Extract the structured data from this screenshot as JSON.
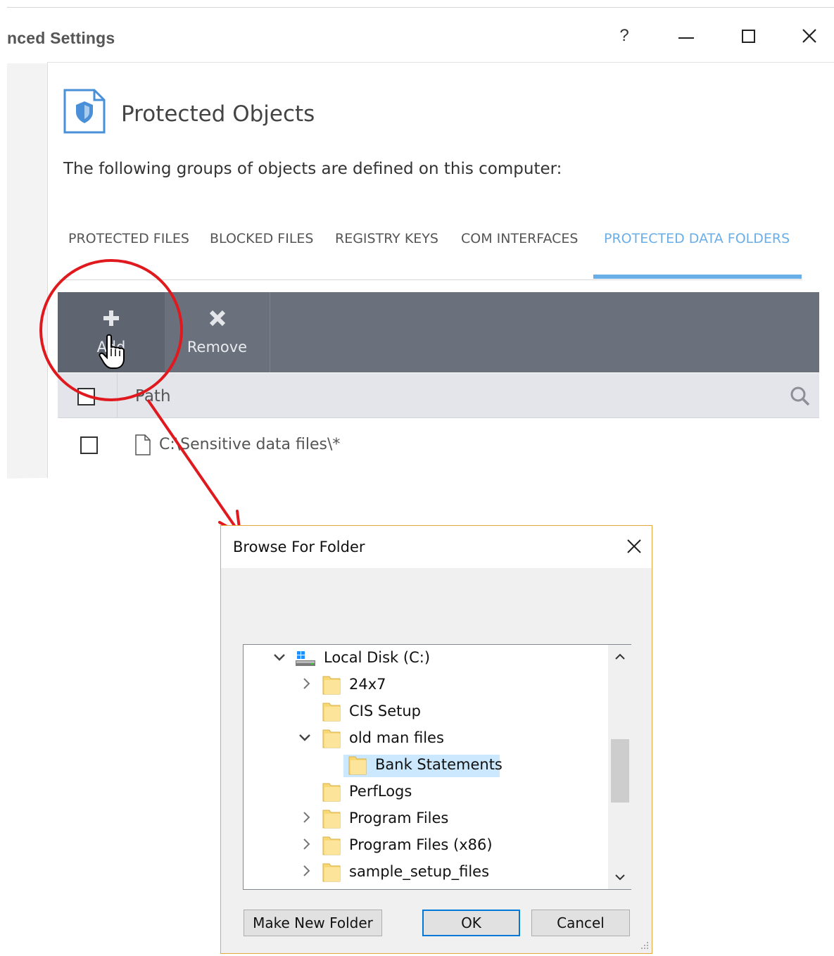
{
  "window": {
    "title": "nced Settings",
    "controls": {
      "help": "?"
    }
  },
  "section": {
    "title": "Protected Objects",
    "description": "The following groups of objects are defined on this computer:"
  },
  "tabs": [
    {
      "label": "PROTECTED FILES",
      "active": false
    },
    {
      "label": "BLOCKED FILES",
      "active": false
    },
    {
      "label": "REGISTRY KEYS",
      "active": false
    },
    {
      "label": "COM INTERFACES",
      "active": false
    },
    {
      "label": "PROTECTED DATA FOLDERS",
      "active": true
    }
  ],
  "toolbar": {
    "add_label": "Add",
    "add_icon": "plus-icon",
    "remove_label": "Remove",
    "remove_icon": "x-icon"
  },
  "grid": {
    "column_header": "Path",
    "rows": [
      {
        "path": "C:\\Sensitive data files\\*"
      }
    ]
  },
  "dialog": {
    "title": "Browse For Folder",
    "tree": [
      {
        "label": "Local Disk (C:)",
        "icon": "drive-icon",
        "expander": "expanded",
        "selected": false
      },
      {
        "label": "24x7",
        "icon": "folder-icon",
        "expander": "collapsed",
        "selected": false
      },
      {
        "label": "CIS Setup",
        "icon": "folder-icon",
        "expander": "none",
        "selected": false
      },
      {
        "label": "old man files",
        "icon": "folder-icon",
        "expander": "expanded",
        "selected": false
      },
      {
        "label": "Bank Statements",
        "icon": "folder-icon",
        "expander": "none",
        "selected": true
      },
      {
        "label": "PerfLogs",
        "icon": "folder-icon",
        "expander": "none",
        "selected": false
      },
      {
        "label": "Program Files",
        "icon": "folder-icon",
        "expander": "collapsed",
        "selected": false
      },
      {
        "label": "Program Files (x86)",
        "icon": "folder-icon",
        "expander": "collapsed",
        "selected": false
      },
      {
        "label": "sample_setup_files",
        "icon": "folder-icon",
        "expander": "collapsed",
        "selected": false
      }
    ],
    "buttons": {
      "make_new_folder": "Make New Folder",
      "ok": "OK",
      "cancel": "Cancel"
    }
  },
  "colors": {
    "accent_tab": "#6aaee8",
    "toolbar": "#6b717c",
    "annotation": "#e0191e",
    "selection": "#cce8ff",
    "folder": "#f8d775"
  }
}
